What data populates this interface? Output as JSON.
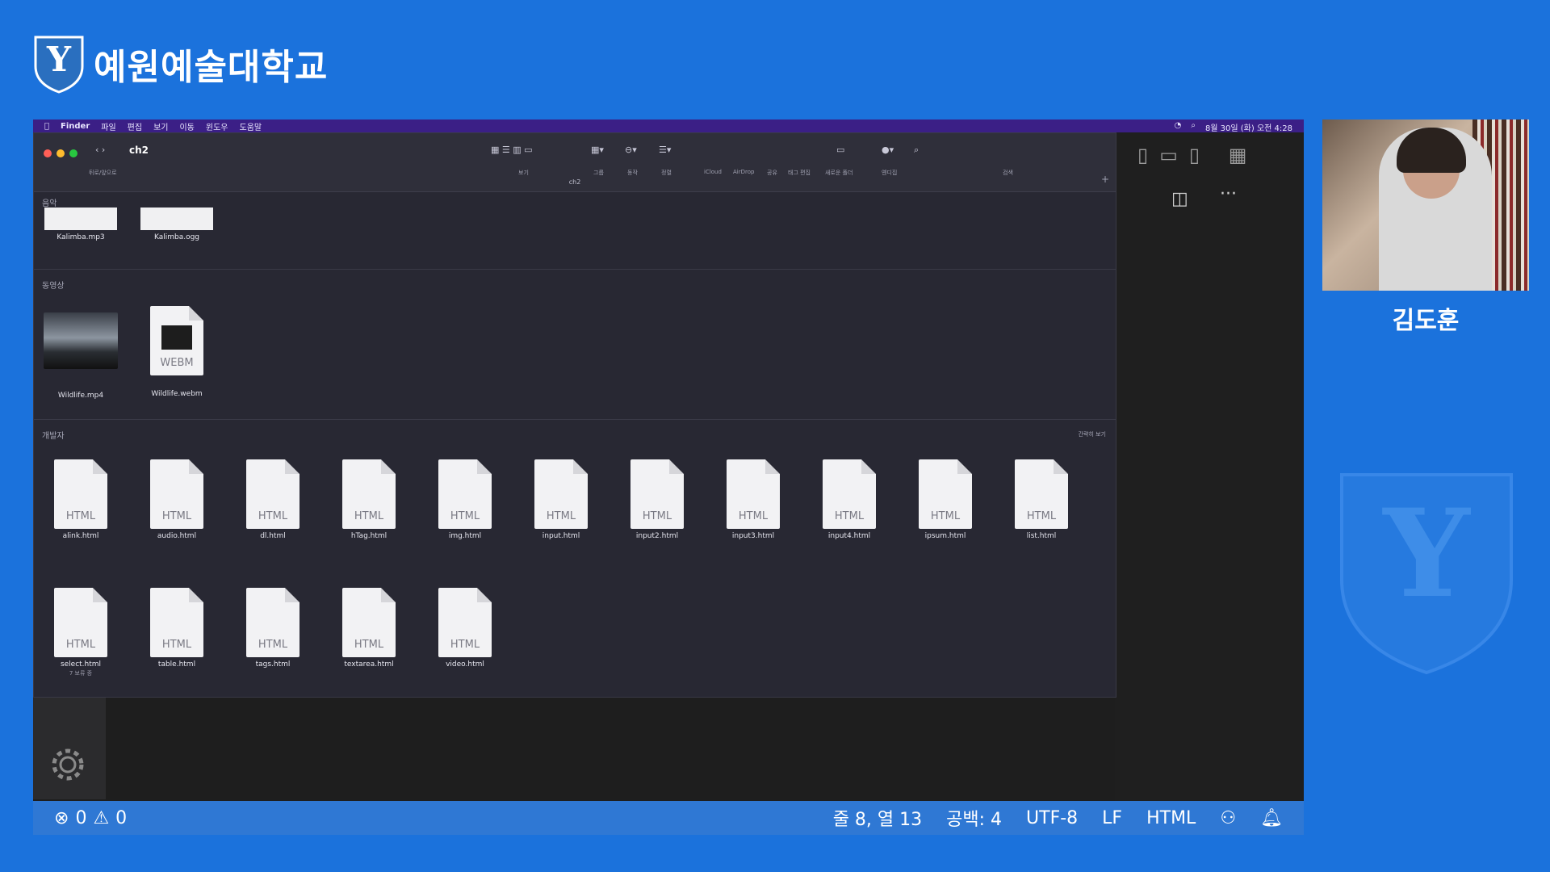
{
  "university": {
    "name": "예원예술대학교"
  },
  "speaker": {
    "name": "김도훈"
  },
  "menubar": {
    "items": [
      "Finder",
      "파일",
      "편집",
      "보기",
      "이동",
      "윈도우",
      "도움말"
    ],
    "clock": "8월 30일 (화) 오전 4:28"
  },
  "finder": {
    "title": "ch2",
    "back_forward_label": "뒤로/앞으로",
    "path_label": "ch2",
    "toolbar_labels": [
      "보기",
      "그룹",
      "동작",
      "정렬",
      "iCloud",
      "AirDrop",
      "공유",
      "태그 편집",
      "새로운 폴더",
      "옌디집",
      "검색"
    ],
    "sections": [
      {
        "title": "음악",
        "files": [
          "Kalimba.mp3",
          "Kalimba.ogg"
        ]
      },
      {
        "title": "동영상",
        "files": [
          "Wildlife.mp4",
          "Wildlife.webm"
        ]
      },
      {
        "title": "개발자",
        "show_less": "간략히 보기",
        "files": [
          "alink.html",
          "audio.html",
          "dl.html",
          "hTag.html",
          "img.html",
          "input.html",
          "input2.html",
          "input3.html",
          "input4.html",
          "ipsum.html",
          "list.html",
          "select.html",
          "table.html",
          "tags.html",
          "textarea.html",
          "video.html"
        ]
      }
    ],
    "ext_html": "HTML",
    "ext_webm": "WEBM",
    "select_sub": "7 보류 중"
  },
  "statusbar": {
    "errors": "0",
    "warnings": "0",
    "position": "줄 8, 열 13",
    "spaces": "공백: 4",
    "encoding": "UTF-8",
    "eol": "LF",
    "language": "HTML"
  },
  "colors": {
    "background": "#1b72dc",
    "statusbar": "#2f78d4",
    "menubar": "#3b1f86",
    "finder": "#282833"
  }
}
